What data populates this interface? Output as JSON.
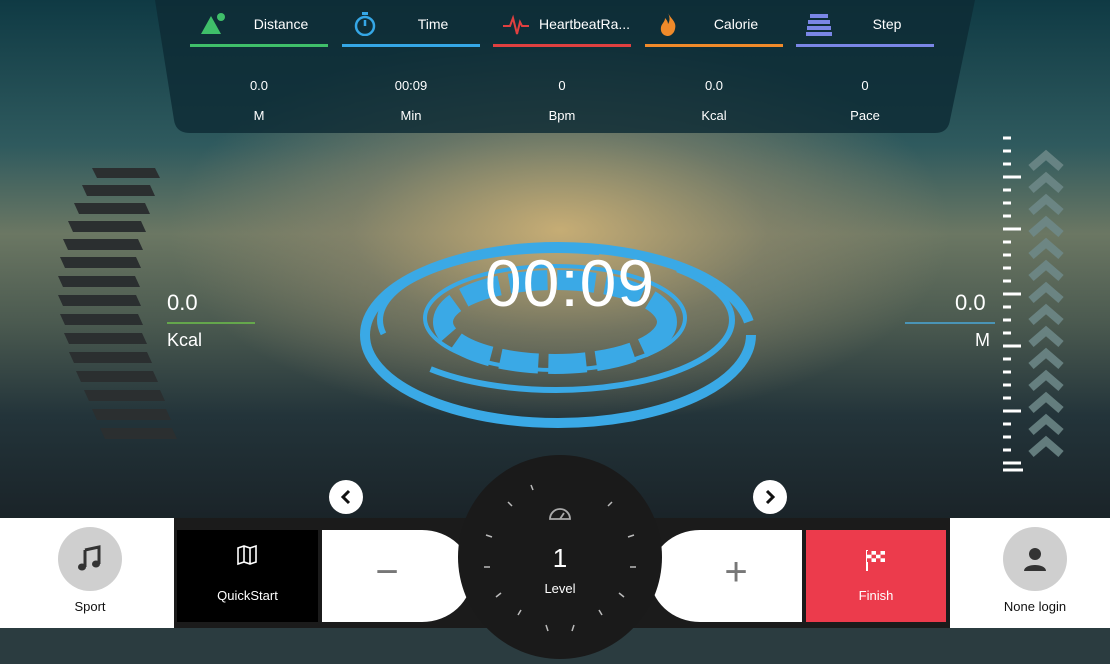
{
  "stats": [
    {
      "label": "Distance",
      "value": "0.0",
      "unit": "M",
      "color": "#3fbf6a",
      "icon": "mountain-icon"
    },
    {
      "label": "Time",
      "value": "00:09",
      "unit": "Min",
      "color": "#35a7e6",
      "icon": "stopwatch-icon"
    },
    {
      "label": "HeartbeatRa...",
      "value": "0",
      "unit": "Bpm",
      "color": "#e04040",
      "icon": "heartbeat-icon"
    },
    {
      "label": "Calorie",
      "value": "0.0",
      "unit": "Kcal",
      "color": "#f08a2a",
      "icon": "flame-icon"
    },
    {
      "label": "Step",
      "value": "0",
      "unit": "Pace",
      "color": "#7a86e6",
      "icon": "stairs-icon"
    }
  ],
  "left_indicator": {
    "value": "0.0",
    "unit": "Kcal",
    "line_color": "#6cc04a"
  },
  "right_indicator": {
    "value": "0.0",
    "unit": "M",
    "line_color": "#4aa8d8"
  },
  "timer": "00:09",
  "controls": {
    "sport_label": "Sport",
    "quickstart_label": "QuickStart",
    "minus_label": "−",
    "plus_label": "+",
    "level_value": "1",
    "level_label": "Level",
    "finish_label": "Finish",
    "login_label": "None login"
  },
  "colors": {
    "ring": "#3aa9e6",
    "finish": "#ec3b4c",
    "level_arc": "#6fd0a0"
  }
}
